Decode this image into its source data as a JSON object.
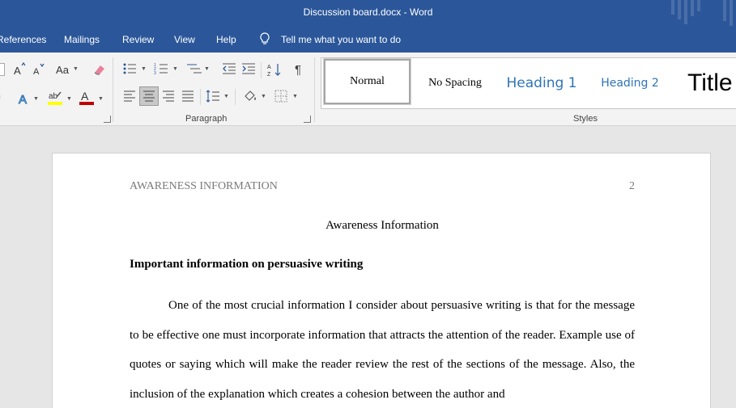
{
  "titlebar": {
    "title": "Discussion board.docx  -  Word"
  },
  "menu": {
    "tabs": [
      "References",
      "Mailings",
      "Review",
      "View",
      "Help"
    ],
    "tell_me": "Tell me what you want to do"
  },
  "ribbon": {
    "font": {
      "change_case": "Aa"
    },
    "paragraph_label": "Paragraph",
    "styles_label": "Styles",
    "styles": [
      "Normal",
      "No Spacing",
      "Heading 1",
      "Heading 2",
      "Title"
    ]
  },
  "document": {
    "header_left": "AWARENESS INFORMATION",
    "header_page": "2",
    "title": "Awareness Information",
    "heading": "Important information on persuasive writing",
    "paragraph": "One of the most crucial information I consider about persuasive writing is that for the message to be effective one must incorporate information that attracts the attention of the reader. Example use of quotes or saying which will make the reader review the rest of the sections of the message. Also, the inclusion of the explanation which creates a cohesion between the author and"
  },
  "colors": {
    "word_blue": "#2b579a",
    "heading_blue": "#2e74b5",
    "highlight_yellow": "#ffff00",
    "font_red": "#c00000"
  }
}
